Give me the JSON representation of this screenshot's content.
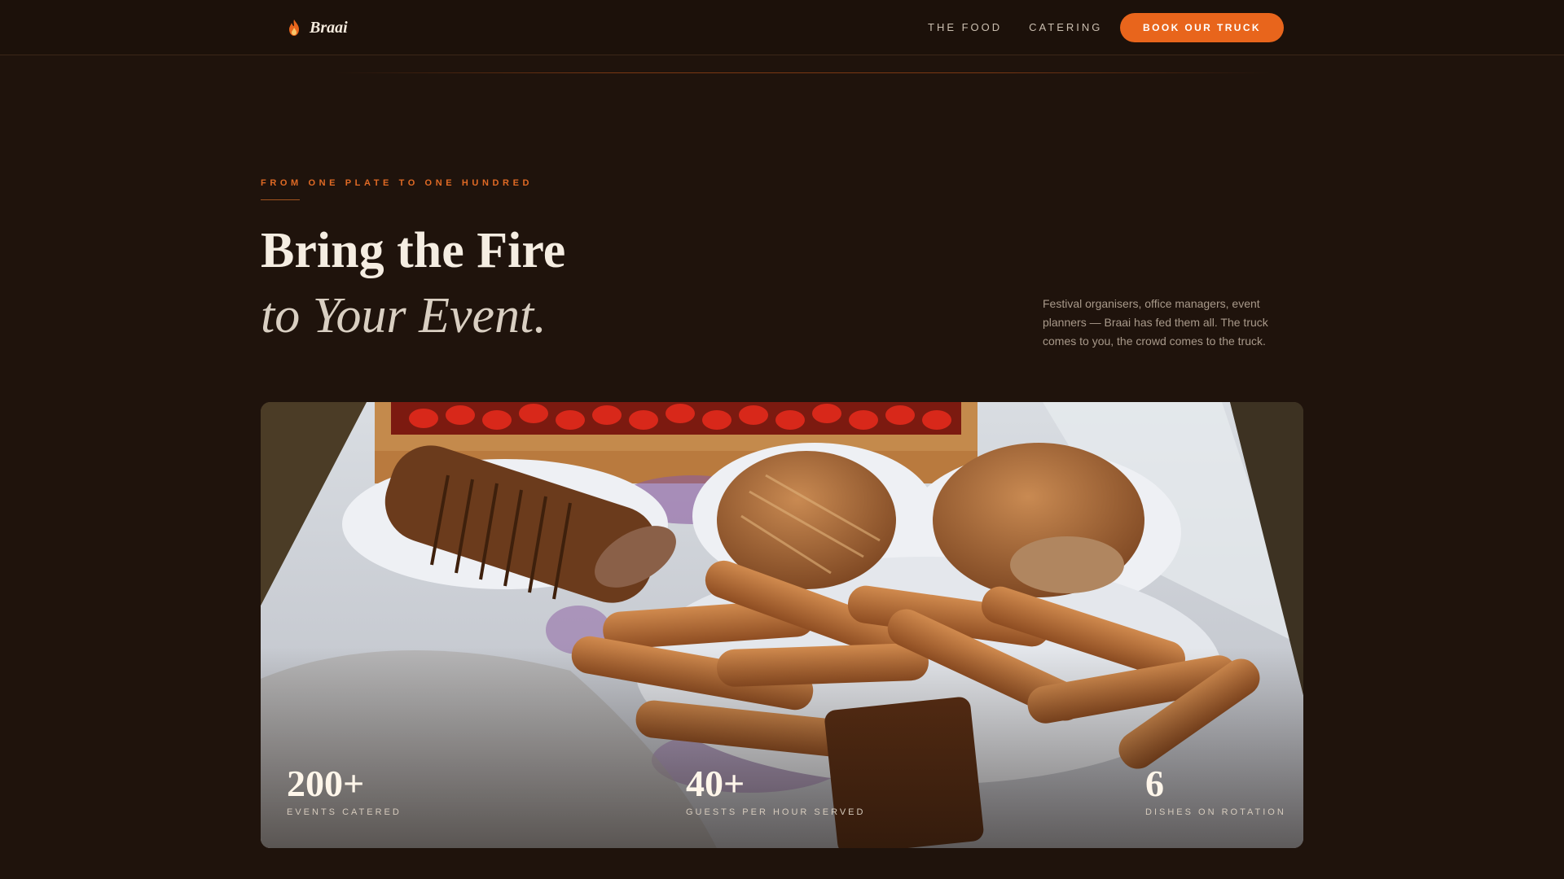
{
  "nav": {
    "brand": "Braai",
    "brand_icon": "flame-icon",
    "links": [
      "THE FOOD",
      "CATERING"
    ],
    "cta": "BOOK OUR TRUCK"
  },
  "hero": {
    "eyebrow": "FROM ONE PLATE TO ONE HUNDRED",
    "title_line1": "Bring the Fire",
    "title_line2": "to Your Event.",
    "blurb": "Festival organisers, office managers, event planners — Braai has fed them all. The truck comes to you, the crowd comes to the truck."
  },
  "stats": [
    {
      "value": "200+",
      "label": "EVENTS CATERED"
    },
    {
      "value": "40+",
      "label": "GUESTS PER HOUR SERVED"
    },
    {
      "value": "6",
      "label": "DISHES ON ROTATION"
    }
  ],
  "colors": {
    "background": "#1f130c",
    "accent": "#e8651c",
    "text": "#f3e9dc"
  }
}
